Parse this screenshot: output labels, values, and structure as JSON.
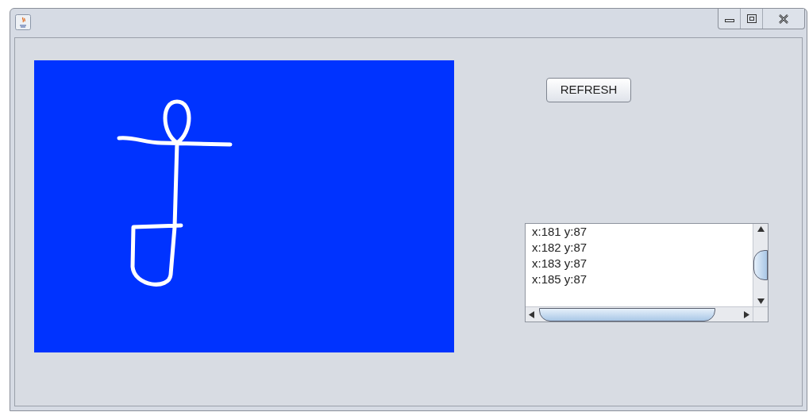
{
  "refresh_button": {
    "label": "REFRESH"
  },
  "coordinates_list": {
    "items": [
      {
        "text": "x:181 y:87"
      },
      {
        "text": "x:182 y:87"
      },
      {
        "text": "x:183 y:87"
      },
      {
        "text": "x:185 y:87"
      }
    ]
  }
}
